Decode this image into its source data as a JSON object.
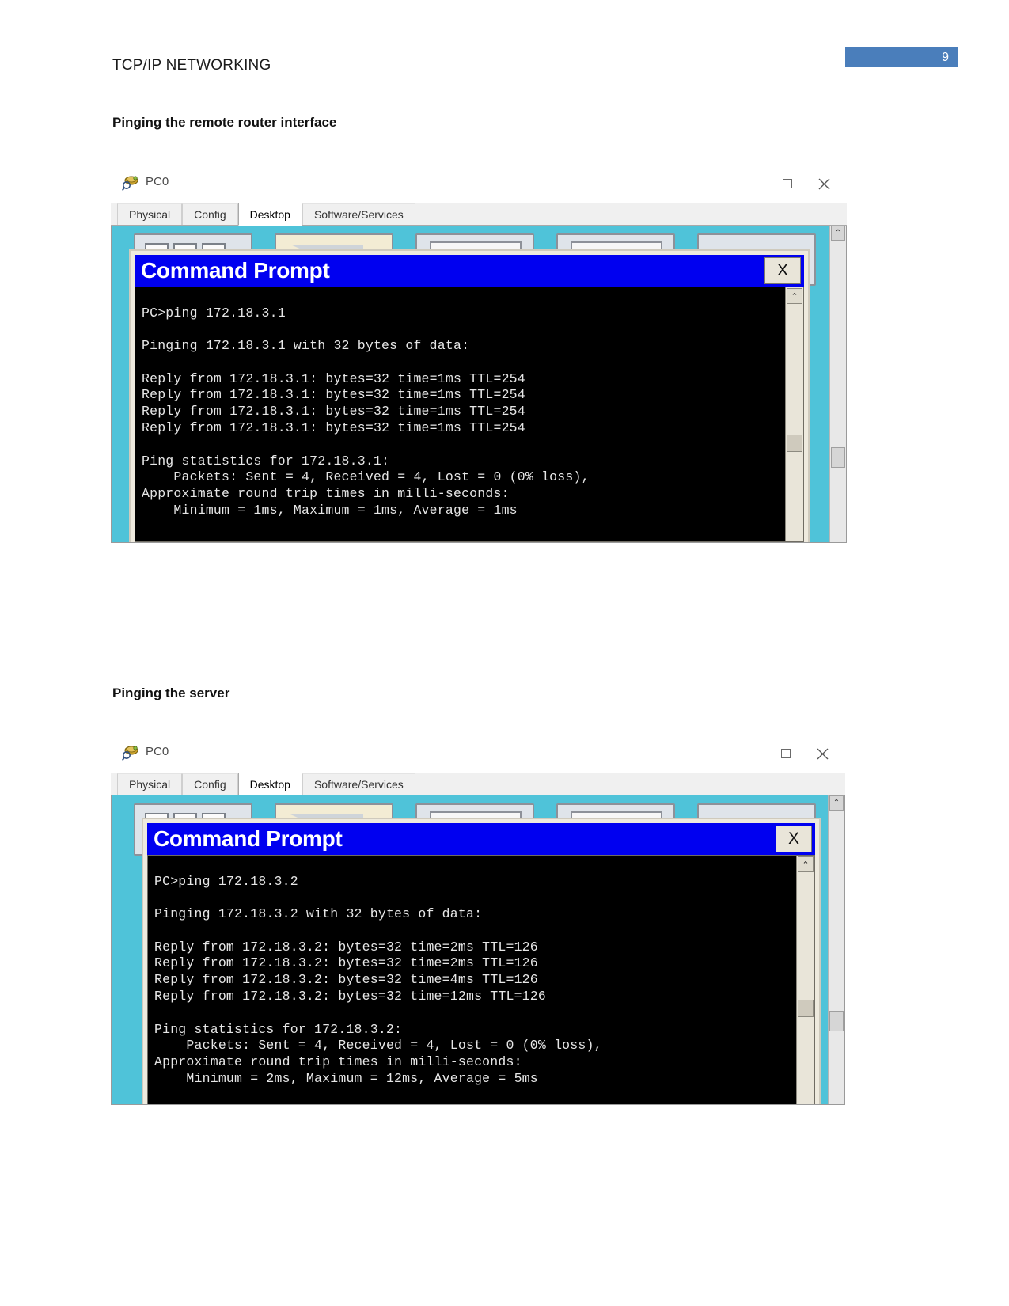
{
  "document": {
    "header_title": "TCP/IP NETWORKING",
    "page_number": "9",
    "accent_color": "#4a7ebb",
    "headings": {
      "section_1": "Pinging the remote router interface",
      "section_2": "Pinging the server"
    }
  },
  "figures": [
    {
      "id": "figure-1",
      "window": {
        "app_icon_name": "packet-tracer-pc-icon",
        "title": "PC0",
        "controls": {
          "minimize": "—",
          "maximize": "□",
          "close": "✕"
        },
        "tabs": [
          {
            "label": "Physical",
            "active": false
          },
          {
            "label": "Config",
            "active": false
          },
          {
            "label": "Desktop",
            "active": true
          },
          {
            "label": "Software/Services",
            "active": false
          }
        ],
        "scroll_up_glyph": "⌃"
      },
      "command_prompt": {
        "title": "Command Prompt",
        "close_label": "X",
        "scroll_up_glyph": "⌃",
        "output": "PC>ping 172.18.3.1\n\nPinging 172.18.3.1 with 32 bytes of data:\n\nReply from 172.18.3.1: bytes=32 time=1ms TTL=254\nReply from 172.18.3.1: bytes=32 time=1ms TTL=254\nReply from 172.18.3.1: bytes=32 time=1ms TTL=254\nReply from 172.18.3.1: bytes=32 time=1ms TTL=254\n\nPing statistics for 172.18.3.1:\n    Packets: Sent = 4, Received = 4, Lost = 0 (0% loss),\nApproximate round trip times in milli-seconds:\n    Minimum = 1ms, Maximum = 1ms, Average = 1ms"
      }
    },
    {
      "id": "figure-2",
      "window": {
        "app_icon_name": "packet-tracer-pc-icon",
        "title": "PC0",
        "controls": {
          "minimize": "—",
          "maximize": "□",
          "close": "✕"
        },
        "tabs": [
          {
            "label": "Physical",
            "active": false
          },
          {
            "label": "Config",
            "active": false
          },
          {
            "label": "Desktop",
            "active": true
          },
          {
            "label": "Software/Services",
            "active": false
          }
        ],
        "scroll_up_glyph": "⌃"
      },
      "command_prompt": {
        "title": "Command Prompt",
        "close_label": "X",
        "scroll_up_glyph": "⌃",
        "output": "PC>ping 172.18.3.2\n\nPinging 172.18.3.2 with 32 bytes of data:\n\nReply from 172.18.3.2: bytes=32 time=2ms TTL=126\nReply from 172.18.3.2: bytes=32 time=2ms TTL=126\nReply from 172.18.3.2: bytes=32 time=4ms TTL=126\nReply from 172.18.3.2: bytes=32 time=12ms TTL=126\n\nPing statistics for 172.18.3.2:\n    Packets: Sent = 4, Received = 4, Lost = 0 (0% loss),\nApproximate round trip times in milli-seconds:\n    Minimum = 2ms, Maximum = 12ms, Average = 5ms"
      }
    }
  ]
}
